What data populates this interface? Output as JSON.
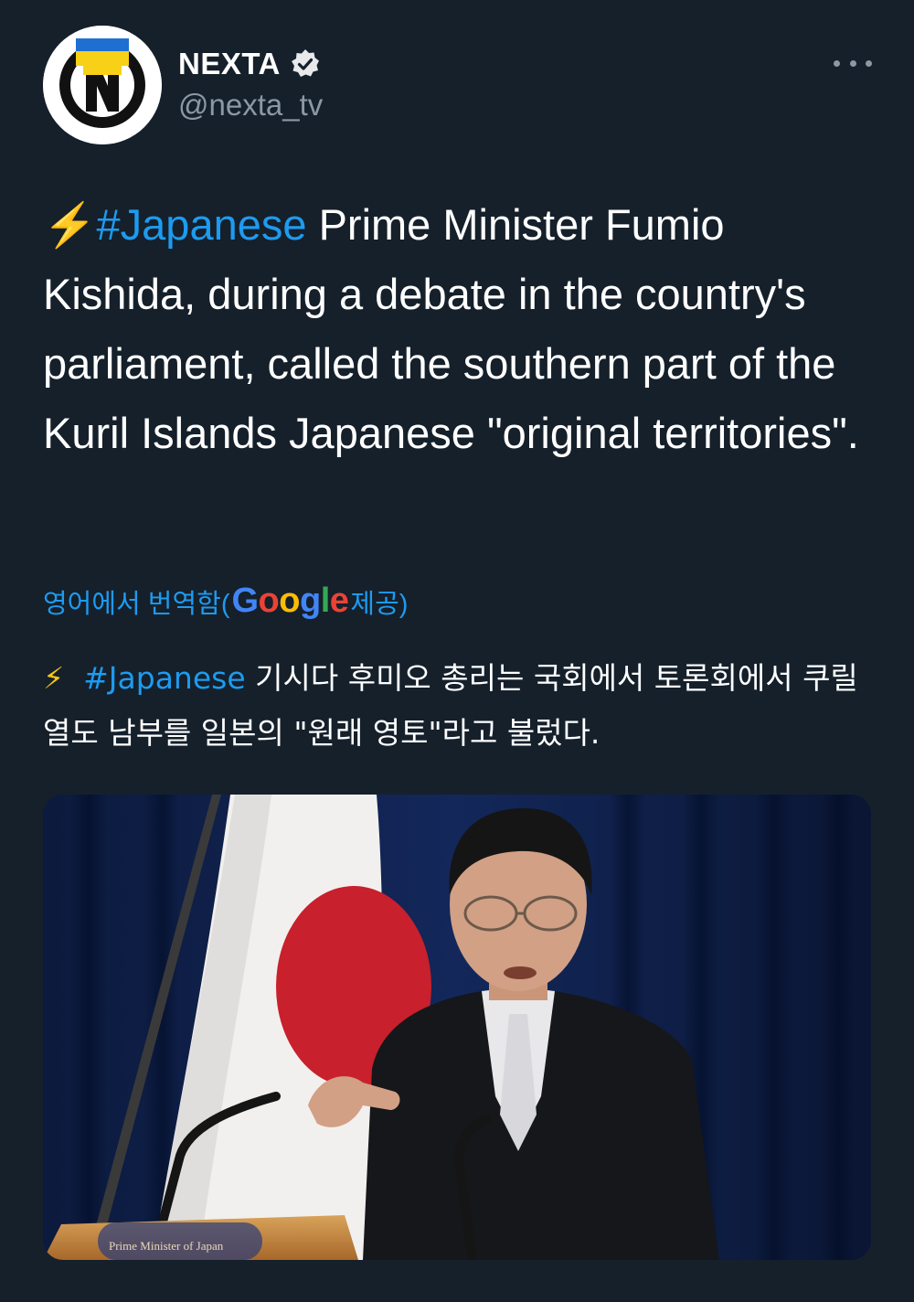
{
  "account": {
    "display_name": "NEXTA",
    "handle": "@nexta_tv",
    "verified": true,
    "avatar_icon": "nexta-logo"
  },
  "tweet": {
    "emoji": "⚡",
    "hashtag": "#Japanese",
    "text": " Prime Minister Fumio Kishida, during a debate in the country's parliament, called the southern part of the Kuril Islands Japanese \"original territories\"."
  },
  "translation": {
    "label_prefix": "영어에서 번역함(",
    "provider": "Google",
    "label_suffix": " 제공)",
    "emoji": "⚡",
    "hashtag": "#Japanese",
    "text": " 기시다 후미오 총리는 국회에서 토론회에서 쿠릴 열도 남부를 일본의 \"원래 영토\"라고 불렀다."
  },
  "media": {
    "podium_text": "Prime Minister of Japan"
  },
  "colors": {
    "background": "#15202b",
    "link": "#1d9bf0",
    "secondary_text": "#8b98a5"
  }
}
